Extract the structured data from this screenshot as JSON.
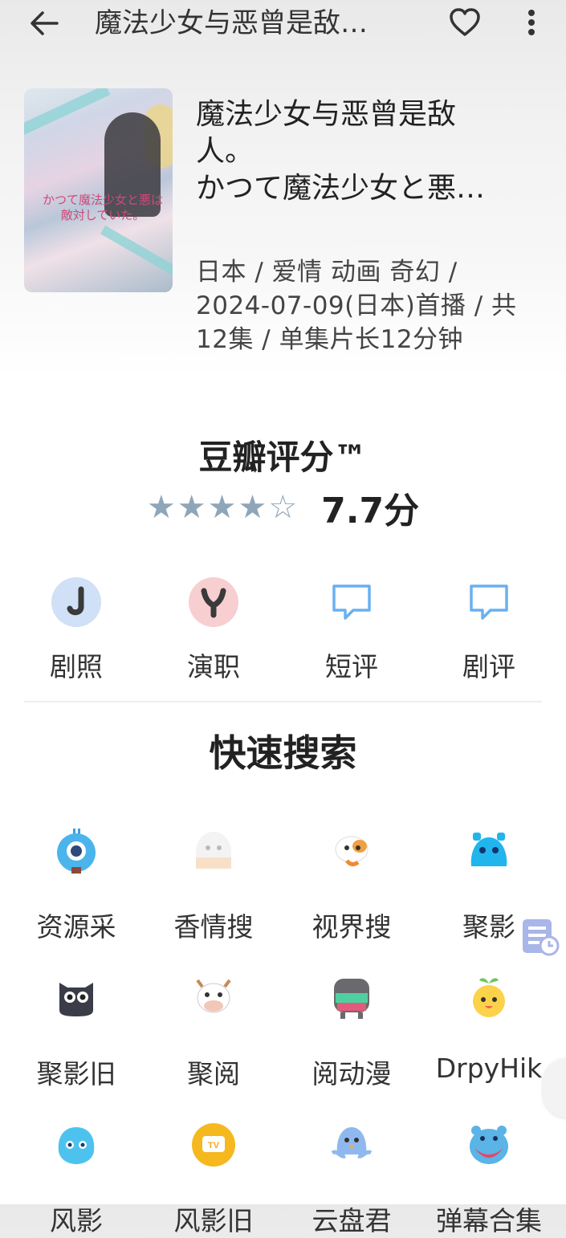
{
  "header": {
    "title": "魔法少女与恶曾是敌…",
    "back_icon": "arrow-left-icon",
    "favorite_icon": "heart-outline-icon",
    "more_icon": "more-vertical-icon"
  },
  "info": {
    "poster_title": "かつて魔法少女と悪は敵対していた。",
    "name_line1": "魔法少女与恶曾是敌",
    "name_line2": "人。",
    "name_line3": "かつて魔法少女と悪…",
    "meta_line1": "日本 / 爱情 动画 奇幻 /",
    "meta_line2": "2024-07-09(日本)首播 / 共",
    "meta_line3": "12集 / 单集片长12分钟"
  },
  "rating": {
    "title": "豆瓣评分™",
    "stars_filled": 4,
    "stars_total": 5,
    "score_text": "7.7分",
    "star_color": "#8fa6b9"
  },
  "actions": [
    {
      "label": "剧照",
      "icon": "stills-icon",
      "color": "#cfe0f7"
    },
    {
      "label": "演职",
      "icon": "cast-icon",
      "color": "#f7cfd0"
    },
    {
      "label": "短评",
      "icon": "comment-icon",
      "color": "#6ab0f0"
    },
    {
      "label": "剧评",
      "icon": "review-icon",
      "color": "#6ab0f0"
    }
  ],
  "quick_search": {
    "title": "快速搜索",
    "items": [
      {
        "label": "资源采",
        "icon": "eye-robot-icon"
      },
      {
        "label": "香情搜",
        "icon": "ghost-icon"
      },
      {
        "label": "视界搜",
        "icon": "dog-icon"
      },
      {
        "label": "聚影",
        "icon": "blue-cat-icon"
      },
      {
        "label": "聚影旧",
        "icon": "owl-icon"
      },
      {
        "label": "聚阅",
        "icon": "cow-icon"
      },
      {
        "label": "阅动漫",
        "icon": "robot-icon"
      },
      {
        "label": "DrpyHik",
        "icon": "orange-sprout-icon"
      },
      {
        "label": "风影",
        "icon": "blue-blob-icon"
      },
      {
        "label": "风影旧",
        "icon": "tv-icon"
      },
      {
        "label": "云盘君",
        "icon": "bird-icon"
      },
      {
        "label": "弹幕合集",
        "icon": "hippo-icon"
      }
    ]
  },
  "floating": {
    "history_icon": "history-list-icon",
    "edge_icon": "edge-handle-icon"
  }
}
